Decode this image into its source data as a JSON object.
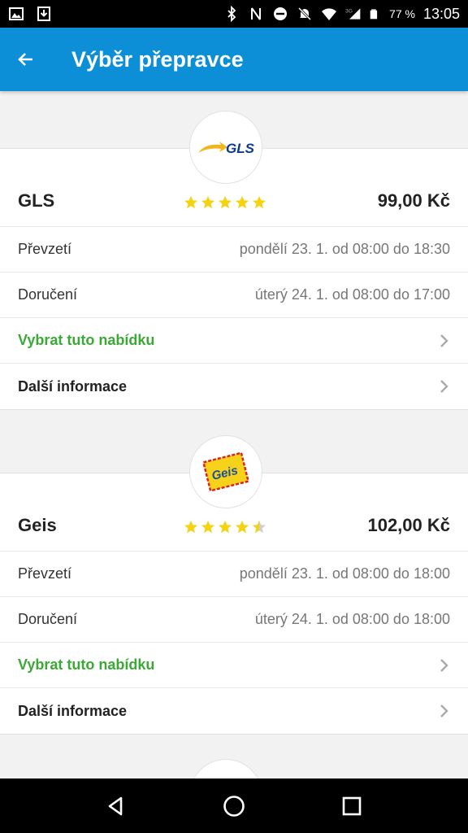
{
  "status_bar": {
    "battery_percent": "77 %",
    "time": "13:05",
    "network": "3G"
  },
  "app_bar": {
    "title": "Výběr přepravce"
  },
  "carriers": [
    {
      "logo_text": "GLS",
      "name": "GLS",
      "rating": 5,
      "price": "99,00 Kč",
      "pickup_label": "Převzetí",
      "pickup_value": "pondělí 23. 1. od 08:00 do 18:30",
      "delivery_label": "Doručení",
      "delivery_value": "úterý 24. 1. od 08:00 do 17:00",
      "select_label": "Vybrat tuto nabídku",
      "info_label": "Další informace"
    },
    {
      "logo_text": "Geis",
      "name": "Geis",
      "rating": 4.5,
      "price": "102,00 Kč",
      "pickup_label": "Převzetí",
      "pickup_value": "pondělí 23. 1. od 08:00 do 18:00",
      "delivery_label": "Doručení",
      "delivery_value": "úterý 24. 1. od 08:00 do 18:00",
      "select_label": "Vybrat tuto nabídku",
      "info_label": "Další informace"
    }
  ],
  "colors": {
    "app_bar": "#0d8fd8",
    "action_green": "#3aa935",
    "star_yellow": "#f5d311"
  }
}
